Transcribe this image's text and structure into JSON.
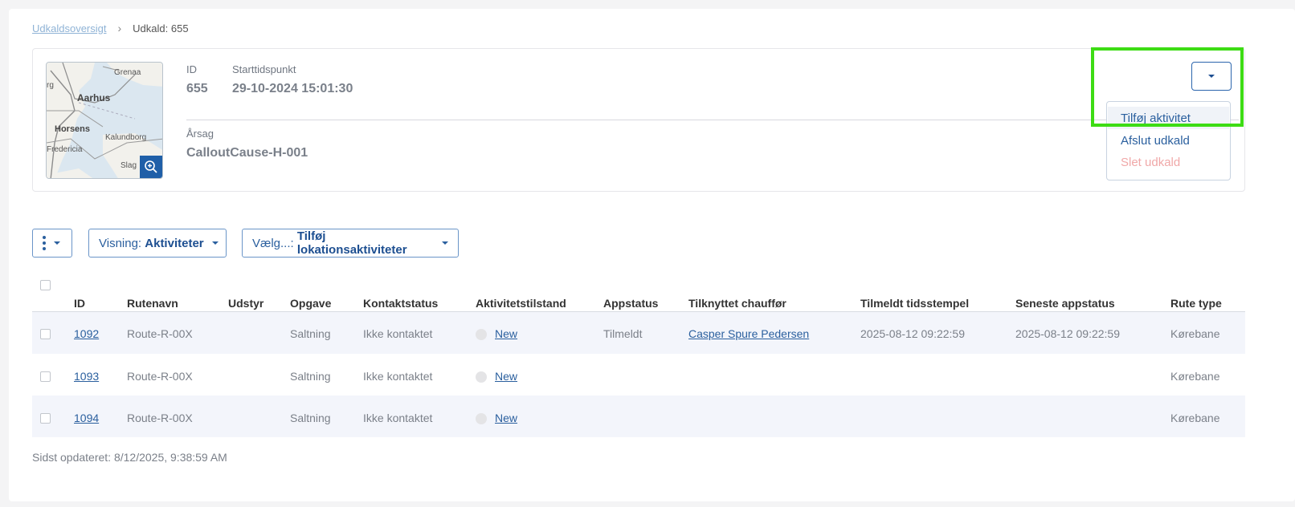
{
  "breadcrumb": {
    "parent": "Udkaldsoversigt",
    "current": "Udkald: 655"
  },
  "callout": {
    "id_label": "ID",
    "id_value": "655",
    "start_label": "Starttidspunkt",
    "start_value": "29-10-2024 15:01:30",
    "cause_label": "Årsag",
    "cause_value": "CalloutCause-H-001"
  },
  "map": {
    "labels": [
      "Grenaa",
      "rg",
      "Aarhus",
      "Horsens",
      "Kalundborg",
      "Fredericia",
      "Slag"
    ]
  },
  "actions_menu": {
    "items": [
      "Tilføj aktivitet",
      "Afslut udkald",
      "Slet udkald"
    ]
  },
  "toolbar": {
    "view_prefix": "Visning: ",
    "view_value": "Aktiviteter",
    "choose_prefix": "Vælg...: ",
    "choose_value": "Tilføj lokationsaktiviteter"
  },
  "table": {
    "columns": [
      "ID",
      "Rutenavn",
      "Udstyr",
      "Opgave",
      "Kontaktstatus",
      "Aktivitetstilstand",
      "Appstatus",
      "Tilknyttet chauffør",
      "Tilmeldt tidsstempel",
      "Seneste appstatus",
      "Rute type"
    ],
    "rows": [
      {
        "id": "1092",
        "route": "Route-R-00X",
        "equipment": "",
        "task": "Saltning",
        "contact": "Ikke kontaktet",
        "state": "New",
        "app_status": "Tilmeldt",
        "driver": "Casper Spure Pedersen",
        "registered": "2025-08-12 09:22:59",
        "latest": "2025-08-12 09:22:59",
        "route_type": "Kørebane"
      },
      {
        "id": "1093",
        "route": "Route-R-00X",
        "equipment": "",
        "task": "Saltning",
        "contact": "Ikke kontaktet",
        "state": "New",
        "app_status": "",
        "driver": "",
        "registered": "",
        "latest": "",
        "route_type": "Kørebane"
      },
      {
        "id": "1094",
        "route": "Route-R-00X",
        "equipment": "",
        "task": "Saltning",
        "contact": "Ikke kontaktet",
        "state": "New",
        "app_status": "",
        "driver": "",
        "registered": "",
        "latest": "",
        "route_type": "Kørebane"
      }
    ]
  },
  "footer": {
    "last_updated": "Sidst opdateret: 8/12/2025, 9:38:59 AM"
  },
  "colors": {
    "accent": "#2a5f9e",
    "highlight": "#3ddc14",
    "danger": "#f0a8a8"
  },
  "icons": {
    "breadcrumb_separator": "chevron-right-icon",
    "map_zoom": "zoom-in-icon",
    "toolbar_menu": "kebab-icon",
    "dropdown": "caret-down-icon"
  }
}
